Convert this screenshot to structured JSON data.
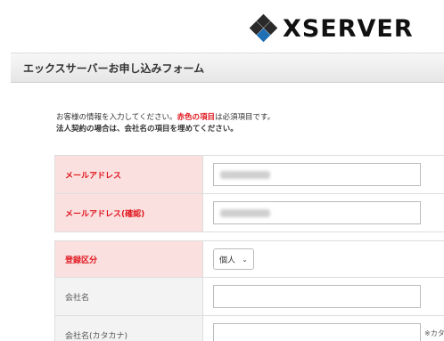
{
  "logo": {
    "text": "XSERVER"
  },
  "header": {
    "title": "エックスサーバーお申し込みフォーム"
  },
  "intro": {
    "line1_pre": "お客様の情報を入力してください。",
    "line1_red": "赤色の項目",
    "line1_post": "は必須項目です。",
    "line2": "法人契約の場合は、会社名の項目を埋めてください。"
  },
  "fields": {
    "email": {
      "label": "メールアドレス",
      "value": ""
    },
    "email_confirm": {
      "label": "メールアドレス(確認)",
      "value": ""
    },
    "registration_type": {
      "label": "登録区分",
      "selected": "個人"
    },
    "company_name": {
      "label": "会社名",
      "value": ""
    },
    "company_name_kana": {
      "label": "会社名(カタカナ)",
      "value": "",
      "note": "※カタ"
    }
  },
  "colors": {
    "required_bg": "#fbe0e0",
    "required_text": "#e0161d",
    "logo_accent": "#1f6fb5"
  }
}
